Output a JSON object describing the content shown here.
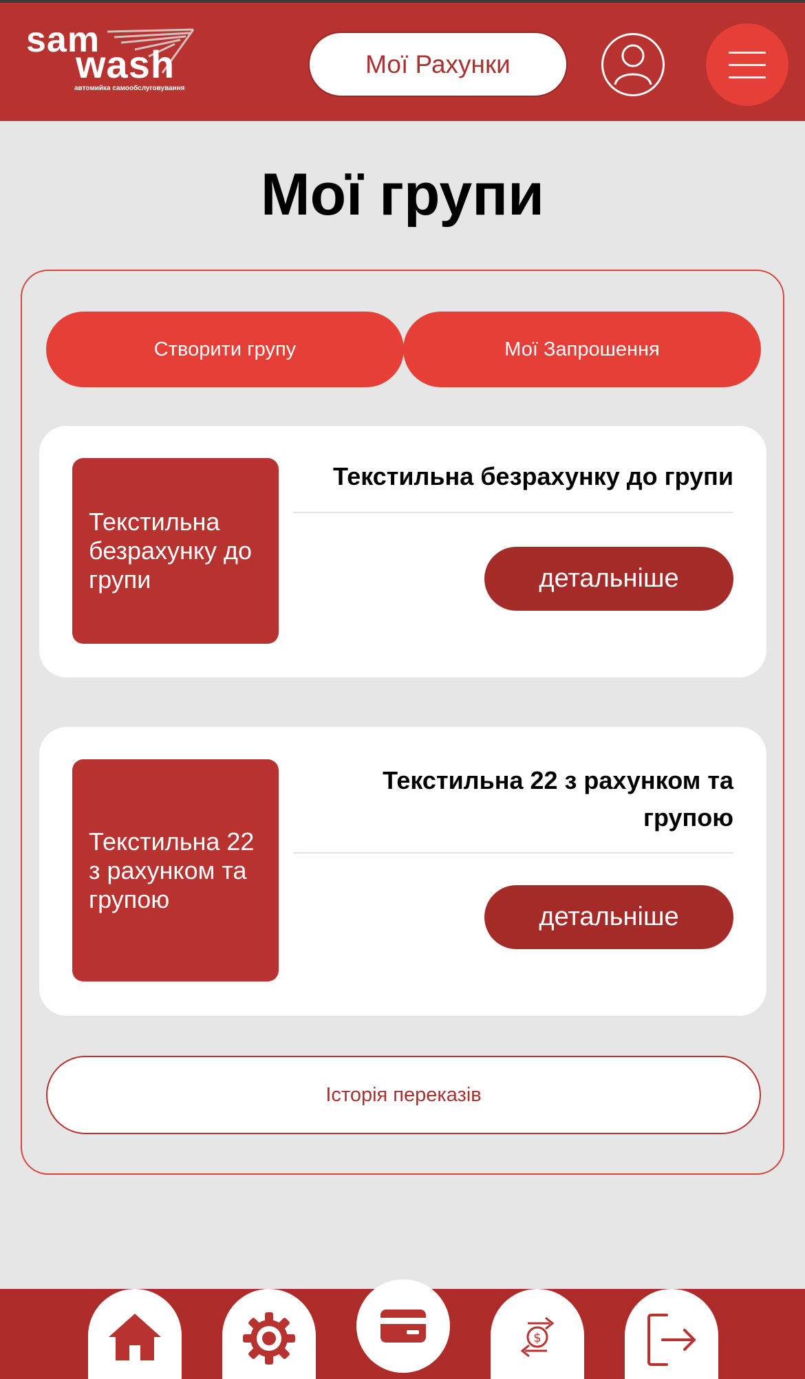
{
  "header": {
    "logo": {
      "line1": "sam",
      "line2": "wash",
      "tagline": "автомийка самообслуговування"
    },
    "accounts_button": "Мої Рахунки"
  },
  "page": {
    "title": "Мої групи"
  },
  "actions": {
    "create_group": "Створити групу",
    "my_invites": "Мої Запрошення"
  },
  "groups": [
    {
      "thumb_text": "Текстильна безрахунку до групи",
      "title": "Текстильна безрахунку до групи",
      "details": "детальніше"
    },
    {
      "thumb_text": "Текстильна 22 з рахунком та групою",
      "title": "Текстильна 22 з рахунком та групою",
      "details": "детальніше"
    }
  ],
  "history_button": "Історія переказів",
  "bottom_nav": {
    "items": [
      "home-icon",
      "gear-icon",
      "card-icon",
      "money-transfer-icon",
      "logout-icon"
    ],
    "active": "card-icon"
  },
  "colors": {
    "brand_dark": "#b83230",
    "brand_bright": "#e53f38",
    "button_dark": "#a52b29",
    "background": "#e6e6e6"
  }
}
